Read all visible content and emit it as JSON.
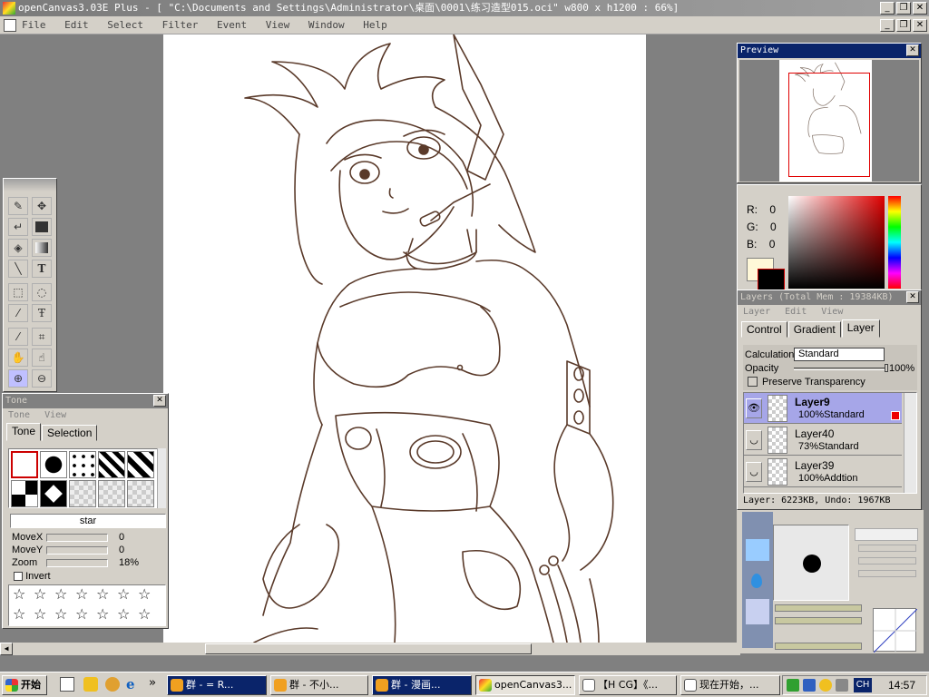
{
  "window": {
    "title": "openCanvas3.03E Plus - [ \"C:\\Documents and Settings\\Administrator\\桌面\\0001\\练习造型015.oci\" w800 x h1200 : 66%]",
    "minimize": "_",
    "restore": "❐",
    "close": "✕"
  },
  "menu": [
    "File",
    "Edit",
    "Select",
    "Filter",
    "Event",
    "View",
    "Window",
    "Help"
  ],
  "tone_panel": {
    "title": "Tone",
    "menu": [
      "Tone",
      "View"
    ],
    "tabs": [
      "Tone",
      "Selection"
    ],
    "pattern_name": "star",
    "sliders": [
      {
        "label": "MoveX",
        "value": "0"
      },
      {
        "label": "MoveY",
        "value": "0"
      },
      {
        "label": "Zoom",
        "value": "18%"
      }
    ],
    "invert_label": "Invert"
  },
  "preview_panel": {
    "title": "Preview"
  },
  "color_panel": {
    "r_label": "R:",
    "r_value": "0",
    "g_label": "G:",
    "g_value": "0",
    "b_label": "B:",
    "b_value": "0",
    "fg_color": "#000000",
    "bg_color": "#fff8d8"
  },
  "layers_panel": {
    "title": "Layers (Total Mem : 19384KB)",
    "menu": [
      "Layer",
      "Edit",
      "View"
    ],
    "tabs": [
      "Control",
      "Gradient",
      "Layer"
    ],
    "calculation_label": "Calculation",
    "calculation_value": "Standard",
    "opacity_label": "Opacity",
    "opacity_value": "100%",
    "preserve_label": "Preserve Transparency",
    "layers": [
      {
        "name": "Layer9",
        "mode": "100%Standard",
        "selected": true
      },
      {
        "name": "Layer40",
        "mode": "73%Standard",
        "selected": false
      },
      {
        "name": "Layer39",
        "mode": "100%Addtion",
        "selected": false
      }
    ],
    "status": "Layer: 6223KB, Undo: 1967KB"
  },
  "taskbar": {
    "start": "开始",
    "items": [
      {
        "label": "群 - = R...",
        "active": false
      },
      {
        "label": "群 - 不小...",
        "active": false
      },
      {
        "label": "群 - 漫画...",
        "active": false
      },
      {
        "label": "openCanvas3...",
        "active": true
      },
      {
        "label": "【H CG】《...",
        "active": false
      },
      {
        "label": "现在开始，...",
        "active": false
      }
    ],
    "chevron": "»",
    "ime": "CH",
    "clock": "14:57"
  },
  "colors": {
    "titlebar_inactive": "#808080",
    "panel_active_title": "#0a246a",
    "panel_bg": "#d4d0c8",
    "layer_selected": "#a6a6e8",
    "lineart": "#5a3a2a"
  }
}
